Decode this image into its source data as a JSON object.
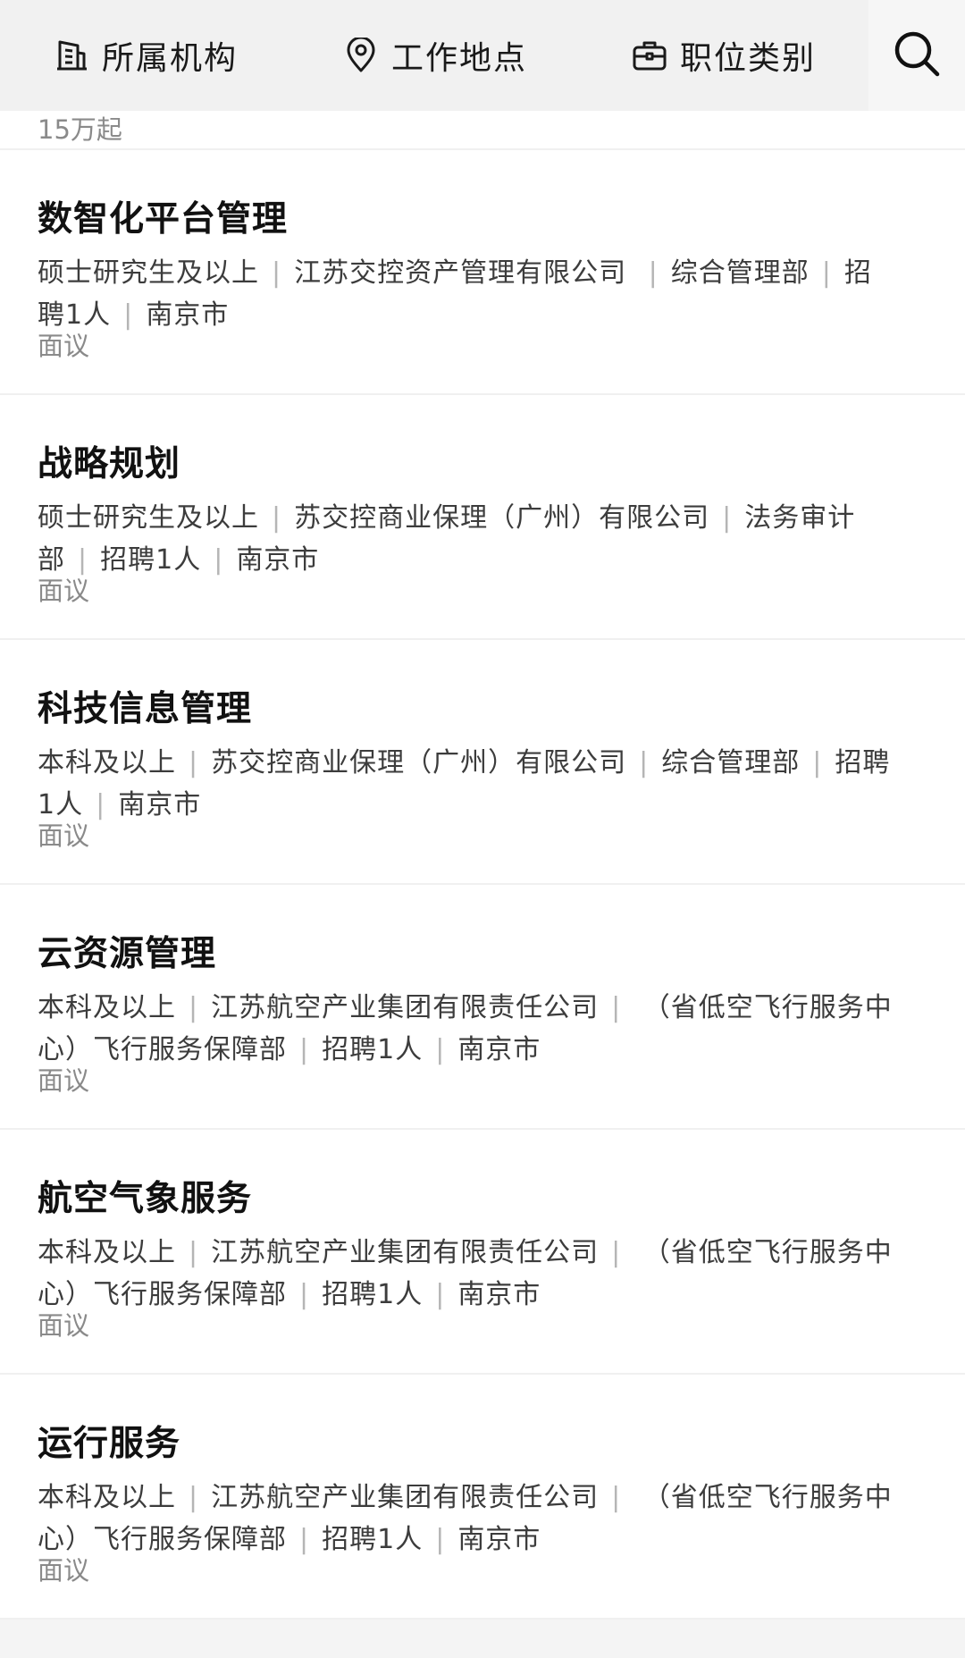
{
  "filters": {
    "org": {
      "label": "所属机构",
      "icon": "building-icon"
    },
    "location": {
      "label": "工作地点",
      "icon": "location-pin-icon"
    },
    "category": {
      "label": "职位类别",
      "icon": "briefcase-icon"
    },
    "search_icon": "search-icon"
  },
  "partial_job": {
    "salary": "15万起"
  },
  "jobs": [
    {
      "title": "数智化平台管理",
      "tags": [
        "硕士研究生及以上",
        "江苏交控资产管理有限公司 ",
        "综合管理部",
        "招聘1人",
        "南京市"
      ],
      "salary": "面议"
    },
    {
      "title": "战略规划",
      "tags": [
        "硕士研究生及以上",
        "苏交控商业保理（广州）有限公司",
        "法务审计部",
        "招聘1人",
        "南京市"
      ],
      "salary": "面议"
    },
    {
      "title": "科技信息管理",
      "tags": [
        "本科及以上",
        "苏交控商业保理（广州）有限公司",
        "综合管理部",
        "招聘1人",
        "南京市"
      ],
      "salary": "面议"
    },
    {
      "title": "云资源管理",
      "tags": [
        "本科及以上",
        "江苏航空产业集团有限责任公司",
        " （省低空飞行服务中心）飞行服务保障部",
        "招聘1人",
        "南京市"
      ],
      "salary": "面议"
    },
    {
      "title": "航空气象服务",
      "tags": [
        "本科及以上",
        "江苏航空产业集团有限责任公司",
        " （省低空飞行服务中心）飞行服务保障部",
        "招聘1人",
        "南京市"
      ],
      "salary": "面议"
    },
    {
      "title": "运行服务",
      "tags": [
        "本科及以上",
        "江苏航空产业集团有限责任公司",
        " （省低空飞行服务中心）飞行服务保障部",
        "招聘1人",
        "南京市"
      ],
      "salary": "面议"
    }
  ],
  "separator": "|"
}
